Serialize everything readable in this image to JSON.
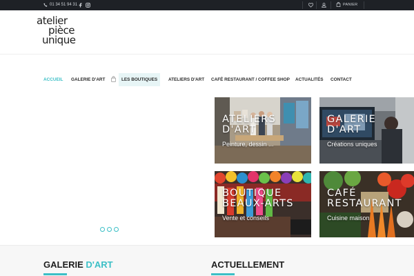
{
  "topbar": {
    "phone": "01 34 51 94 31",
    "cart_label": "PANIER"
  },
  "logo": {
    "line1": "atelier",
    "line2": "pièce",
    "line3": "unique"
  },
  "nav": {
    "items": [
      {
        "label": "ACCUEIL"
      },
      {
        "label": "GALERIE D'ART"
      },
      {
        "label": "LES BOUTIQUES"
      },
      {
        "label": "ATELIERS D'ART"
      },
      {
        "label": "CAFÉ RESTAURANT / COFFEE SHOP"
      },
      {
        "label": "ACTUALITÉS"
      },
      {
        "label": "CONTACT"
      }
    ]
  },
  "tiles": [
    {
      "title": "ATELIERS\nD'ART",
      "subtitle": "Peinture, dessin ..."
    },
    {
      "title": "GALERIE\nD'ART",
      "subtitle": "Créations uniques"
    },
    {
      "title": "BOUTIQUE\nBEAUX-ARTS",
      "subtitle": "Vente et conseils"
    },
    {
      "title": "CAFÉ\nRESTAURANT",
      "subtitle": "Cuisine maison"
    }
  ],
  "sections": {
    "galerie_part1": "GALERIE ",
    "galerie_part2": "D'ART",
    "actuellement": "ACTUELLEMENT"
  },
  "colors": {
    "accent": "#3bbfc6",
    "topbar": "#1e2126"
  }
}
